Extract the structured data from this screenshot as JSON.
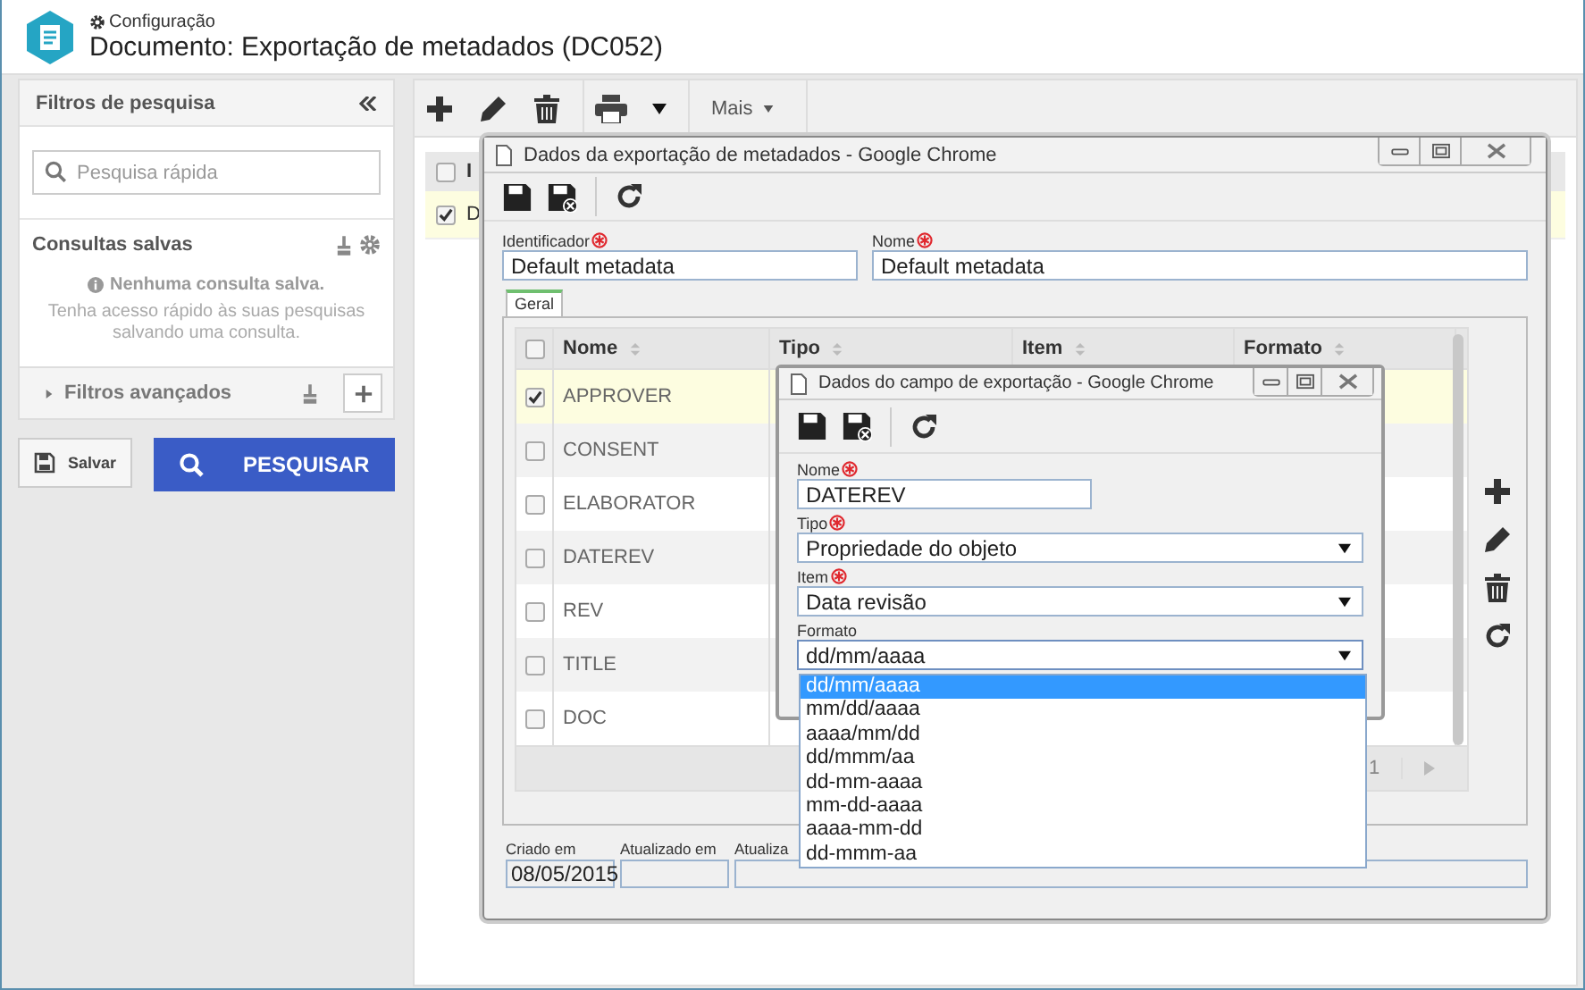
{
  "header": {
    "breadcrumb": "Configuração",
    "title": "Documento: Exportação de metadados (DC052)"
  },
  "sidebar": {
    "title": "Filtros de pesquisa",
    "search": {
      "placeholder": "Pesquisa rápida"
    },
    "saved_title": "Consultas salvas",
    "empty_title": "Nenhuma consulta salva.",
    "empty_hint": "Tenha acesso rápido às suas pesquisas salvando uma consulta.",
    "advanced": {
      "label": "Filtros avançados",
      "expanded": false
    },
    "save": "Salvar",
    "search_button": "PESQUISAR"
  },
  "toolbar": {
    "more": "Mais"
  },
  "list": {
    "column": "I",
    "all_selected": false,
    "rows": [
      {
        "cell": "D",
        "selected": true
      }
    ]
  },
  "dialog": {
    "title": "Dados da exportação de metadados - Google Chrome",
    "fields": [
      {
        "label": "Identificador",
        "required": true,
        "value": "Default metadata"
      },
      {
        "label": "Nome",
        "required": true,
        "value": "Default metadata"
      }
    ],
    "tabs": [
      {
        "label": "Geral",
        "selected": true
      }
    ],
    "grid": {
      "columns": [
        "Nome",
        "Tipo",
        "Item",
        "Formato"
      ],
      "all_selected": false,
      "rows": [
        {
          "name": "APPROVER",
          "selected": true
        },
        {
          "name": "CONSENT",
          "selected": false
        },
        {
          "name": "ELABORATOR",
          "selected": false
        },
        {
          "name": "DATEREV",
          "selected": false
        },
        {
          "name": "REV",
          "selected": false
        },
        {
          "name": "TITLE",
          "selected": false
        },
        {
          "name": "DOC",
          "selected": false
        }
      ],
      "page": "1"
    },
    "footer": [
      {
        "label": "Criado em",
        "value": "08/05/2015"
      },
      {
        "label": "Atualizado em"
      },
      {
        "label": "Atualiza"
      }
    ]
  },
  "subdialog": {
    "title": "Dados do campo de exportação - Google Chrome",
    "fields": [
      {
        "label": "Nome",
        "required": true,
        "kind": "text",
        "value": "DATEREV"
      },
      {
        "label": "Tipo",
        "required": true,
        "kind": "select",
        "value": "Propriedade do objeto"
      },
      {
        "label": "Item",
        "required": true,
        "kind": "select",
        "value": "Data revisão"
      },
      {
        "label": "Formato",
        "required": false,
        "kind": "select",
        "value": "dd/mm/aaaa"
      }
    ],
    "options": [
      {
        "label": "dd/mm/aaaa",
        "selected": true
      },
      {
        "label": "mm/dd/aaaa",
        "selected": false
      },
      {
        "label": "aaaa/mm/dd",
        "selected": false
      },
      {
        "label": "dd/mmm/aa",
        "selected": false
      },
      {
        "label": "dd-mm-aaaa",
        "selected": false
      },
      {
        "label": "mm-dd-aaaa",
        "selected": false
      },
      {
        "label": "aaaa-mm-dd",
        "selected": false
      },
      {
        "label": "dd-mmm-aa",
        "selected": false
      }
    ]
  }
}
